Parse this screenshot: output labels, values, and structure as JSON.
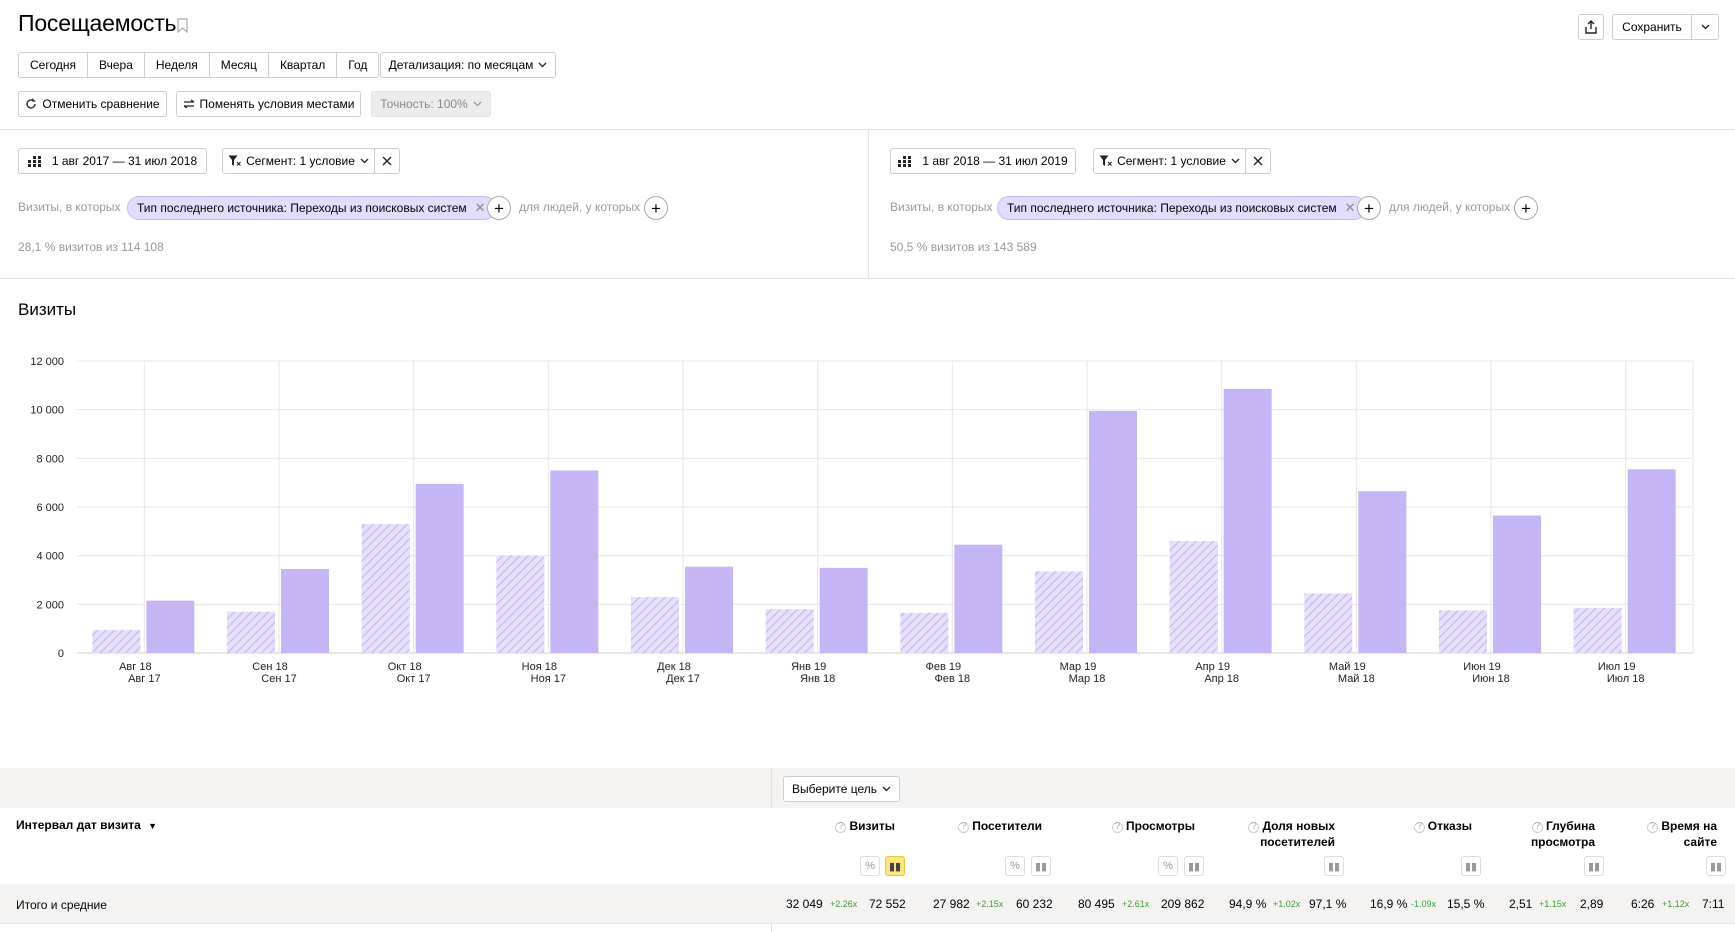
{
  "header": {
    "title": "Посещаемость",
    "share_icon": "share-icon",
    "save_label": "Сохранить"
  },
  "periods": [
    "Сегодня",
    "Вчера",
    "Неделя",
    "Месяц",
    "Квартал",
    "Год"
  ],
  "detail_label": "Детализация: по месяцам",
  "toolbar": {
    "cancel_compare": "Отменить сравнение",
    "swap_conditions": "Поменять условия местами",
    "accuracy": "Точность: 100%"
  },
  "segments": [
    {
      "date_range": "1 авг 2017 — 31 июл 2018",
      "segment_label": "Сегмент: 1 условие",
      "visits_prefix": "Визиты, в которых",
      "chip": "Тип последнего источника: Переходы из поисковых систем",
      "people_label": "для людей, у которых",
      "share": "28,1 % визитов из 114 108"
    },
    {
      "date_range": "1 авг 2018 — 31 июл 2019",
      "segment_label": "Сегмент: 1 условие",
      "visits_prefix": "Визиты, в которых",
      "chip": "Тип последнего источника: Переходы из поисковых систем",
      "people_label": "для людей, у которых",
      "share": "50,5 % визитов из 143 589"
    }
  ],
  "chart_title": "Визиты",
  "chart_data": {
    "type": "bar",
    "title": "Визиты",
    "categories": [
      [
        "Авг 18",
        "Авг 17"
      ],
      [
        "Сен 18",
        "Сен 17"
      ],
      [
        "Окт 18",
        "Окт 17"
      ],
      [
        "Ноя 18",
        "Ноя 17"
      ],
      [
        "Дек 18",
        "Дек 17"
      ],
      [
        "Янв 19",
        "Янв 18"
      ],
      [
        "Фев 19",
        "Фев 18"
      ],
      [
        "Мар 19",
        "Мар 18"
      ],
      [
        "Апр 19",
        "Апр 18"
      ],
      [
        "Май 19",
        "Май 18"
      ],
      [
        "Июн 19",
        "Июн 18"
      ],
      [
        "Июл 19",
        "Июл 18"
      ]
    ],
    "series": [
      {
        "values": [
          950,
          1700,
          5300,
          4000,
          2300,
          1800,
          1650,
          3350,
          4600,
          2450,
          1750,
          1850
        ],
        "color": "#c5b5f5",
        "pattern": "hatched"
      },
      {
        "values": [
          2150,
          3450,
          6950,
          7500,
          3550,
          3500,
          4450,
          9950,
          10850,
          6650,
          5650,
          7550
        ],
        "color": "#c5b5f5",
        "pattern": "solid"
      }
    ],
    "ylim": [
      0,
      12000
    ],
    "yticks": [
      "0",
      "2 000",
      "4 000",
      "6 000",
      "8 000",
      "10 000",
      "12 000"
    ],
    "grid": true
  },
  "goal_select": "Выберите цель",
  "table": {
    "dimension_header": "Интервал дат визита",
    "columns": [
      "Визиты",
      "Посетители",
      "Просмотры",
      "Доля новых посетителей",
      "Отказы",
      "Глубина просмотра",
      "Время на сайте"
    ],
    "totals_label": "Итого и средние",
    "totals": [
      {
        "a": "32 049",
        "delta": "+2.26x",
        "b": "72 552"
      },
      {
        "a": "27 982",
        "delta": "+2.15x",
        "b": "60 232"
      },
      {
        "a": "80 495",
        "delta": "+2.61x",
        "b": "209 862"
      },
      {
        "a": "94,9 %",
        "delta": "+1.02x",
        "b": "97,1 %"
      },
      {
        "a": "16,9 %",
        "delta": "-1.09x",
        "b": "15,5 %"
      },
      {
        "a": "2,51",
        "delta": "+1.15x",
        "b": "2,89"
      },
      {
        "a": "6:26",
        "delta": "+1.12x",
        "b": "7:11"
      }
    ]
  },
  "colors": {
    "bar": "#c5b5f5",
    "accent": "#fde680",
    "delta_positive": "#3c9d35"
  }
}
